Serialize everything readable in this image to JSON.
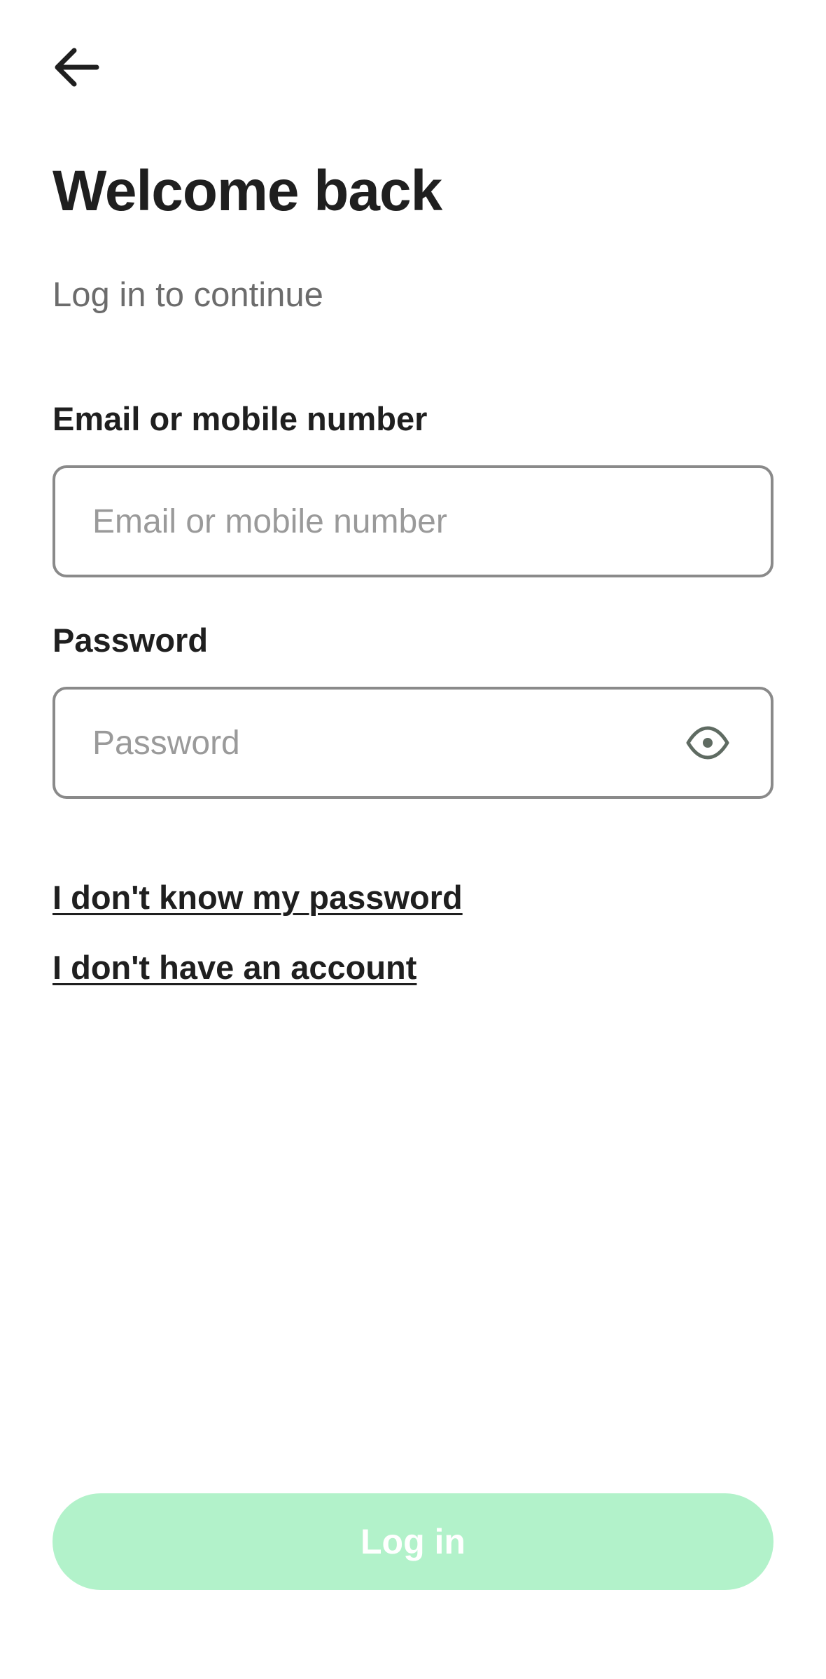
{
  "header": {
    "back_icon": "arrow-left-icon",
    "title": "Welcome back",
    "subtitle": "Log in to continue"
  },
  "form": {
    "email": {
      "label": "Email or mobile number",
      "placeholder": "Email or mobile number",
      "value": ""
    },
    "password": {
      "label": "Password",
      "placeholder": "Password",
      "value": "",
      "toggle_icon": "eye-icon"
    }
  },
  "links": {
    "forgot_password": "I don't know my password",
    "no_account": "I don't have an account"
  },
  "actions": {
    "login_label": "Log in",
    "login_color": "#b2f2ca",
    "login_enabled": false
  },
  "colors": {
    "text_primary": "#1f1f1f",
    "text_secondary": "#6c6c6c",
    "field_border": "#8a8a8a",
    "accent_disabled": "#b2f2ca"
  }
}
